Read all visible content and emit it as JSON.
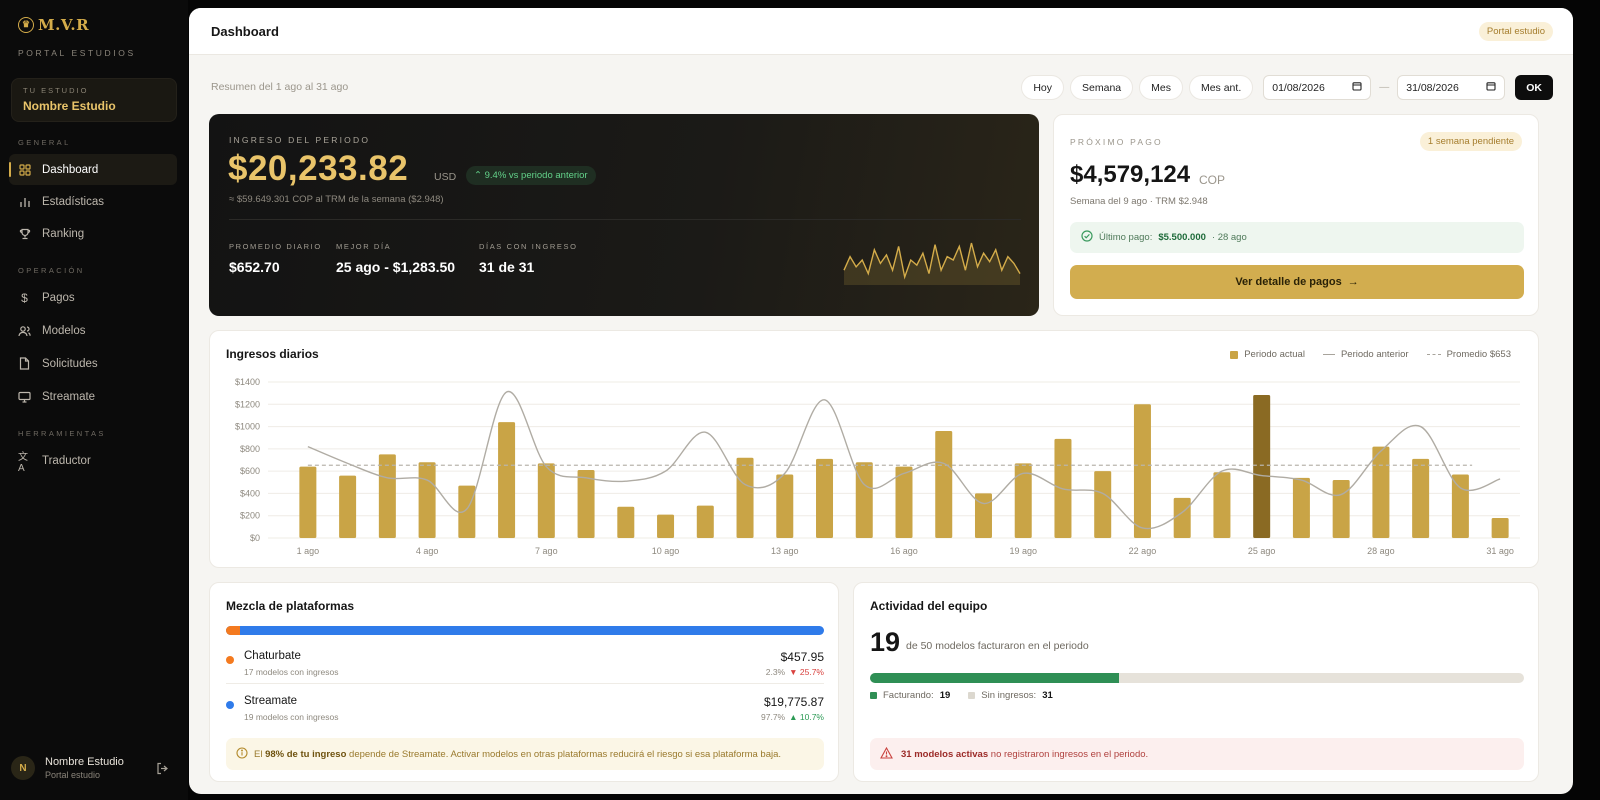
{
  "brand": {
    "logo_text": "M.V.R",
    "portal_label": "PORTAL ESTUDIOS"
  },
  "studio": {
    "label": "TU ESTUDIO",
    "name": "Nombre Estudio"
  },
  "nav": {
    "sections": [
      {
        "title": "GENERAL",
        "items": [
          {
            "label": "Dashboard",
            "icon": "grid-icon",
            "active": true
          },
          {
            "label": "Estadísticas",
            "icon": "bar-chart-icon"
          },
          {
            "label": "Ranking",
            "icon": "trophy-icon"
          }
        ]
      },
      {
        "title": "OPERACIÓN",
        "items": [
          {
            "label": "Pagos",
            "icon": "dollar-icon"
          },
          {
            "label": "Modelos",
            "icon": "users-icon"
          },
          {
            "label": "Solicitudes",
            "icon": "file-icon"
          },
          {
            "label": "Streamate",
            "icon": "monitor-icon"
          }
        ]
      },
      {
        "title": "HERRAMIENTAS",
        "items": [
          {
            "label": "Traductor",
            "icon": "translate-icon"
          }
        ]
      }
    ]
  },
  "user": {
    "initial": "N",
    "name": "Nombre Estudio",
    "subtitle": "Portal estudio"
  },
  "header": {
    "title": "Dashboard",
    "badge": "Portal estudio"
  },
  "summary": "Resumen del 1 ago al 31 ago",
  "filters": {
    "buttons": [
      "Hoy",
      "Semana",
      "Mes",
      "Mes ant."
    ],
    "date_from": "01/08/2026",
    "date_to": "31/08/2026",
    "separator": "—",
    "ok": "OK"
  },
  "revenue": {
    "label": "INGRESO DEL PERIODO",
    "amount": "$20,233.82",
    "currency": "USD",
    "delta": "9.4% vs periodo anterior",
    "cop_note": "≈ $59.649.301 COP al TRM de la semana ($2.948)",
    "stats": [
      {
        "label": "PROMEDIO DIARIO",
        "value": "$652.70"
      },
      {
        "label": "MEJOR DÍA",
        "value": "25 ago - $1,283.50"
      },
      {
        "label": "DÍAS CON INGRESO",
        "value": "31 de 31"
      }
    ]
  },
  "payment": {
    "label": "PRÓXIMO PAGO",
    "badge": "1 semana pendiente",
    "amount": "$4,579,124",
    "currency": "COP",
    "subtitle": "Semana del 9 ago · TRM $2.948",
    "last_prefix": "Último pago:",
    "last_amount": "$5.500.000",
    "last_date": "· 28 ago",
    "button": "Ver detalle de pagos"
  },
  "chart": {
    "title": "Ingresos diarios",
    "legend": {
      "current": "Periodo actual",
      "previous": "Periodo anterior",
      "average": "Promedio $653"
    }
  },
  "chart_data": {
    "type": "bar",
    "title": "Ingresos diarios",
    "categories": [
      "1 ago",
      "2 ago",
      "3 ago",
      "4 ago",
      "5 ago",
      "6 ago",
      "7 ago",
      "8 ago",
      "9 ago",
      "10 ago",
      "11 ago",
      "12 ago",
      "13 ago",
      "14 ago",
      "15 ago",
      "16 ago",
      "17 ago",
      "18 ago",
      "19 ago",
      "20 ago",
      "21 ago",
      "22 ago",
      "23 ago",
      "24 ago",
      "25 ago",
      "26 ago",
      "27 ago",
      "28 ago",
      "29 ago",
      "30 ago",
      "31 ago"
    ],
    "tick_labels": [
      "1 ago",
      "4 ago",
      "7 ago",
      "10 ago",
      "13 ago",
      "16 ago",
      "19 ago",
      "22 ago",
      "25 ago",
      "28 ago",
      "31 ago"
    ],
    "series": [
      {
        "name": "Periodo actual",
        "type": "bar",
        "values": [
          640,
          560,
          750,
          680,
          470,
          1040,
          670,
          610,
          280,
          210,
          290,
          720,
          570,
          710,
          680,
          640,
          960,
          400,
          670,
          890,
          600,
          1200,
          360,
          590,
          1283.5,
          540,
          520,
          820,
          710,
          570,
          180
        ]
      },
      {
        "name": "Periodo anterior",
        "type": "line",
        "values": [
          820,
          670,
          540,
          520,
          260,
          1310,
          640,
          540,
          510,
          600,
          950,
          480,
          580,
          1240,
          480,
          580,
          670,
          310,
          580,
          440,
          400,
          90,
          230,
          600,
          560,
          520,
          390,
          780,
          1000,
          450,
          530
        ]
      }
    ],
    "average": 653,
    "highlight_index": 24,
    "ylim": [
      0,
      1400
    ],
    "yticks": [
      "$0",
      "$200",
      "$400",
      "$600",
      "$800",
      "$1000",
      "$1200",
      "$1400"
    ],
    "grid": true,
    "legend_position": "top-right",
    "colors": {
      "bar": "#c9a446",
      "highlight": "#8a6a23",
      "line": "#b0aca4",
      "average": "#b9b5ad"
    }
  },
  "mix": {
    "title": "Mezcla de plataformas",
    "platforms": [
      {
        "name": "Chaturbate",
        "models": "17 modelos con ingresos",
        "amount": "$457.95",
        "share": "2.3%",
        "change": "▼ 25.7%",
        "share_value": 2.3,
        "color": "#f47a1f"
      },
      {
        "name": "Streamate",
        "models": "19 modelos con ingresos",
        "amount": "$19,775.87",
        "share": "97.7%",
        "change": "▲ 10.7%",
        "share_value": 97.7,
        "color": "#2f7bea"
      }
    ],
    "note_pre": "El",
    "note_bold": "98% de tu ingreso",
    "note_post": "depende de Streamate. Activar modelos en otras plataformas reducirá el riesgo si esa plataforma baja."
  },
  "team": {
    "title": "Actividad del equipo",
    "count": "19",
    "text": "de 50 modelos facturaron en el periodo",
    "billing_label": "Facturando:",
    "billing_value": "19",
    "idle_label": "Sin ingresos:",
    "idle_value": "31",
    "billing_fraction": 0.38,
    "note_bold": "31 modelos activas",
    "note_post": "no registraron ingresos en el periodo."
  },
  "sparkline": [
    30,
    38,
    32,
    36,
    28,
    42,
    34,
    39,
    30,
    44,
    26,
    36,
    33,
    40,
    28,
    45,
    30,
    38,
    36,
    44,
    30,
    46,
    32,
    40,
    35,
    42,
    30,
    38,
    34,
    28
  ]
}
